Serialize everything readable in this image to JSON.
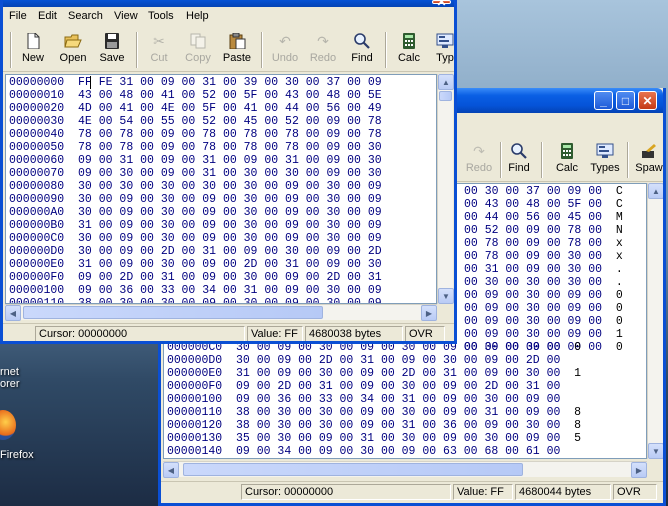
{
  "desktop": {
    "label_internet_1": "rnet",
    "label_internet_2": "orer",
    "label_firefox": "Firefox"
  },
  "front_window": {
    "menu": [
      "File",
      "Edit",
      "Search",
      "View",
      "Tools",
      "Help"
    ],
    "toolbar": {
      "new": "New",
      "open": "Open",
      "save": "Save",
      "cut": "Cut",
      "copy": "Copy",
      "paste": "Paste",
      "undo": "Undo",
      "redo": "Redo",
      "find": "Find",
      "calc": "Calc",
      "types": "Typ"
    },
    "rows": [
      [
        "00000000",
        "FF FE 31 00 09 00 31 00 39 00 30 00 37 00 09"
      ],
      [
        "00000010",
        "43 00 48 00 41 00 52 00 5F 00 43 00 48 00 5E"
      ],
      [
        "00000020",
        "4D 00 41 00 4E 00 5F 00 41 00 44 00 56 00 49"
      ],
      [
        "00000030",
        "4E 00 54 00 55 00 52 00 45 00 52 00 09 00 78"
      ],
      [
        "00000040",
        "78 00 78 00 09 00 78 00 78 00 78 00 09 00 78"
      ],
      [
        "00000050",
        "78 00 78 00 09 00 78 00 78 00 78 00 09 00 30"
      ],
      [
        "00000060",
        "09 00 31 00 09 00 31 00 09 00 31 00 09 00 30"
      ],
      [
        "00000070",
        "09 00 30 00 09 00 31 00 30 00 30 00 09 00 30"
      ],
      [
        "00000080",
        "30 00 30 00 30 00 30 00 30 00 09 00 30 00 09"
      ],
      [
        "00000090",
        "30 00 09 00 30 00 09 00 30 00 09 00 30 00 09"
      ],
      [
        "000000A0",
        "30 00 09 00 30 00 09 00 30 00 09 00 30 00 09"
      ],
      [
        "000000B0",
        "31 00 09 00 30 00 09 00 30 00 09 00 30 00 09"
      ],
      [
        "000000C0",
        "30 00 09 00 30 00 09 00 30 00 09 00 30 00 09"
      ],
      [
        "000000D0",
        "30 00 09 00 2D 00 31 00 09 00 30 00 09 00 2D"
      ],
      [
        "000000E0",
        "31 00 09 00 30 00 09 00 2D 00 31 00 09 00 30"
      ],
      [
        "000000F0",
        "09 00 2D 00 31 00 09 00 30 00 09 00 2D 00 31"
      ],
      [
        "00000100",
        "09 00 36 00 33 00 34 00 31 00 09 00 30 00 09"
      ],
      [
        "00000110",
        "38 00 30 00 30 00 09 00 30 00 09 00 30 00 09"
      ]
    ],
    "status": {
      "cursor": "Cursor: 00000000",
      "value": "Value: FF",
      "size": "4680038 bytes",
      "mode": "OVR"
    }
  },
  "back_window": {
    "toolbar": {
      "redo": "Redo",
      "find": "Find",
      "calc": "Calc",
      "types": "Types",
      "spawn": "Spaw"
    },
    "right_rows": [
      [
        "00 30 00 37 00 09 00",
        "C"
      ],
      [
        "00 43 00 48 00 5F 00",
        "C"
      ],
      [
        "00 44 00 56 00 45 00",
        "M"
      ],
      [
        "00 52 00 09 00 78 00",
        "N"
      ],
      [
        "00 78 00 09 00 78 00",
        "x"
      ],
      [
        "00 78 00 09 00 30 00",
        "x"
      ],
      [
        "00 31 00 09 00 30 00",
        "."
      ],
      [
        "00 30 00 30 00 30 00",
        "."
      ],
      [
        "00 09 00 30 00 09 00",
        "0"
      ],
      [
        "00 09 00 30 00 09 00",
        "0"
      ],
      [
        "00 09 00 30 00 09 00",
        "0"
      ],
      [
        "00 09 00 30 00 09 00",
        "1"
      ],
      [
        "00 09 00 30 00 09 00",
        "0"
      ]
    ],
    "rows": [
      [
        "000000C0",
        "30 00 09 00 30 00 09 00 30 00 09 00 30 00 09 00",
        "0"
      ],
      [
        "000000D0",
        "30 00 09 00 2D 00 31 00 09 00 30 00 09 00 2D 00",
        ""
      ],
      [
        "000000E0",
        "31 00 09 00 30 00 09 00 2D 00 31 00 09 00 30 00",
        "1"
      ],
      [
        "000000F0",
        "09 00 2D 00 31 00 09 00 30 00 09 00 2D 00 31 00",
        ""
      ],
      [
        "00000100",
        "09 00 36 00 33 00 34 00 31 00 09 00 30 00 09 00",
        ""
      ],
      [
        "00000110",
        "38 00 30 00 30 00 09 00 30 00 09 00 31 00 09 00",
        "8"
      ],
      [
        "00000120",
        "38 00 30 00 30 00 09 00 31 00 36 00 09 00 30 00",
        "8"
      ],
      [
        "00000130",
        "35 00 30 00 09 00 31 00 30 00 09 00 30 00 09 00",
        "5"
      ],
      [
        "00000140",
        "09 00 34 00 09 00 30 00 09 00 63 00 68 00 61 00",
        ""
      ]
    ],
    "status": {
      "cursor": "Cursor: 00000000",
      "value": "Value: FF",
      "size": "4680044 bytes",
      "mode": "OVR"
    }
  }
}
